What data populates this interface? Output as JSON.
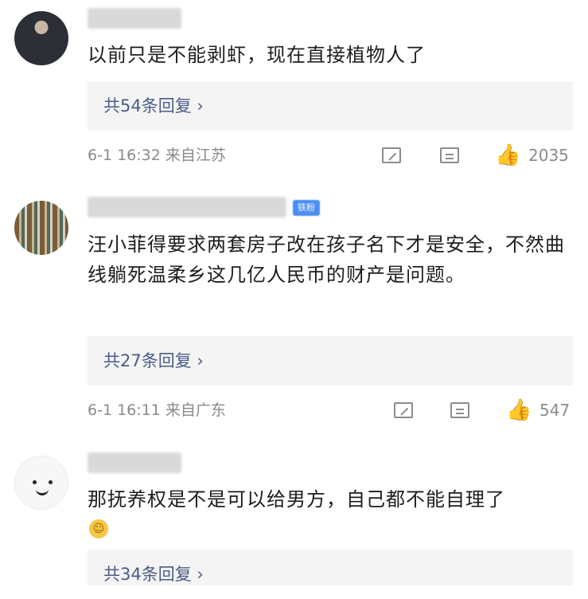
{
  "comments": [
    {
      "text": "以前只是不能剥虾，现在直接植物人了",
      "replies_label": "共54条回复",
      "date": "6-1 16:32",
      "location": "来自江苏",
      "likes": "2035"
    },
    {
      "vip_badge": "铁粉",
      "text": "汪小菲得要求两套房子改在孩子名下才是安全，不然曲线躺死温柔乡这几亿人民币的财产是问题。",
      "replies_label": "共27条回复",
      "date": "6-1 16:11",
      "location": "来自广东",
      "likes": "547"
    },
    {
      "text": "那抚养权是不是可以给男方，自己都不能自理了",
      "replies_label": "共34条回复"
    }
  ],
  "icons": {
    "share": "share-icon",
    "comment": "comment-icon",
    "like": "like-icon",
    "chevron": "chevron-right-icon"
  },
  "colors": {
    "reply_link": "#4a5d86",
    "meta": "#8a8a8a",
    "reply_bg": "#f4f4f4"
  }
}
